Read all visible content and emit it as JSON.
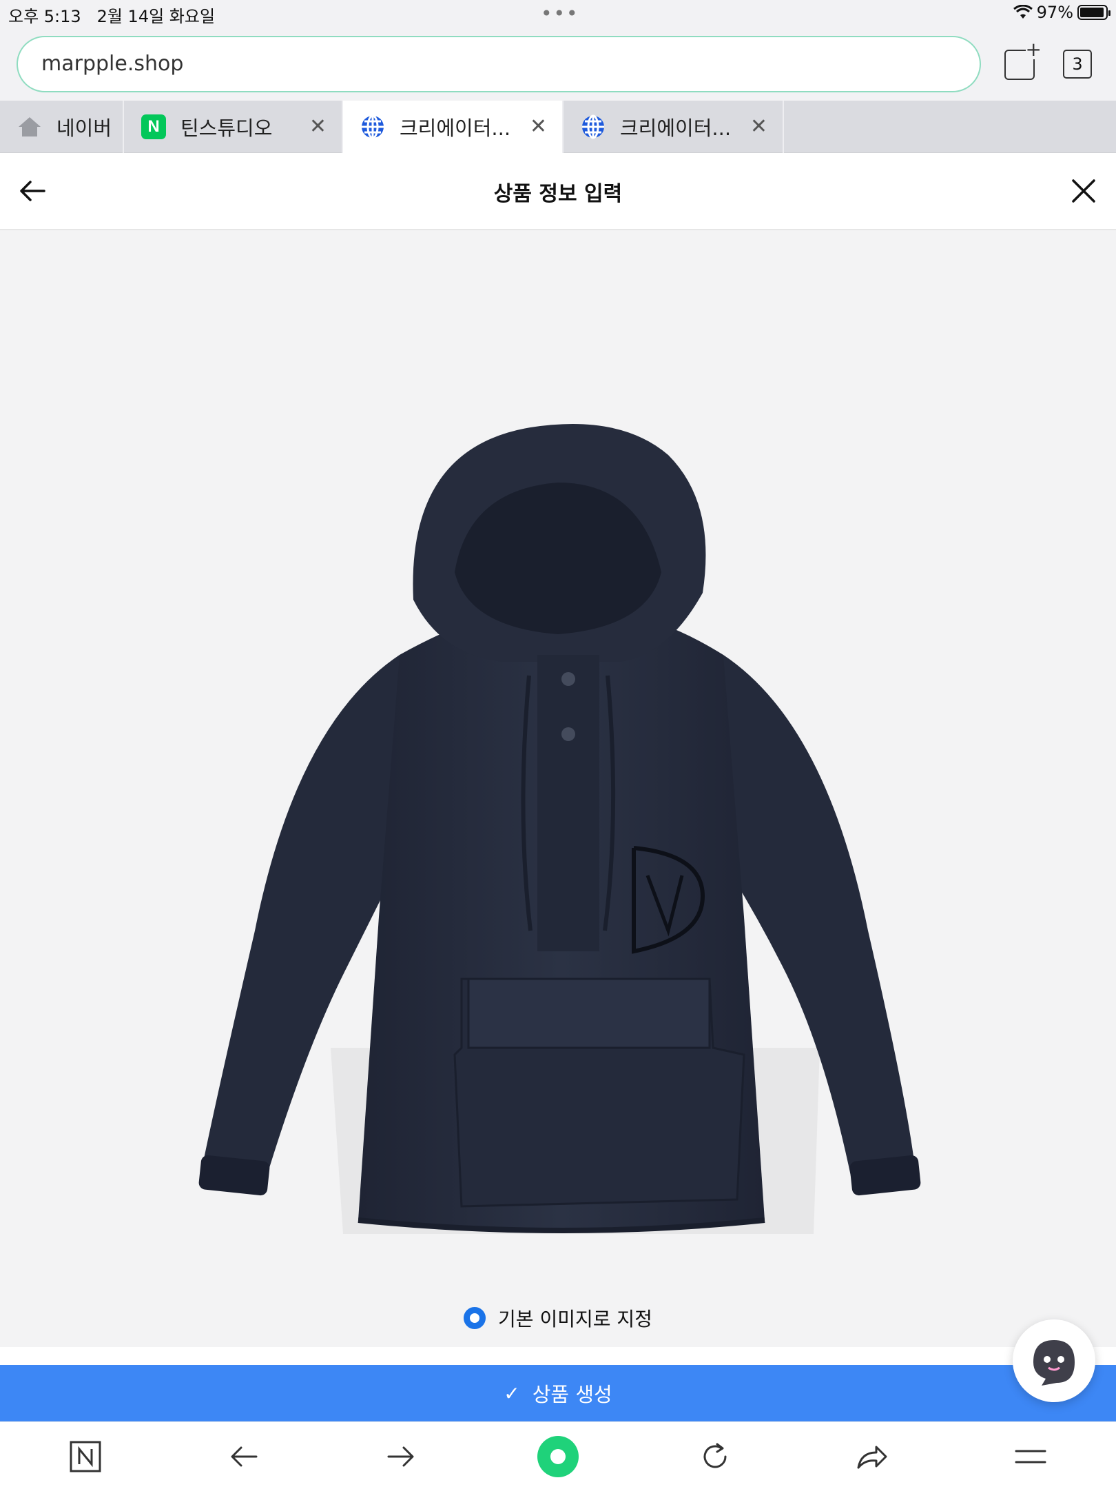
{
  "status_bar": {
    "time": "오후 5:13",
    "date": "2월 14일 화요일",
    "battery": "97%",
    "battery_level": 0.97
  },
  "browser": {
    "url": "marpple.shop",
    "tab_count": "3",
    "tabs": [
      {
        "label": "네이버",
        "icon": "home-icon"
      },
      {
        "label": "틴스튜디오",
        "icon": "naver-icon"
      },
      {
        "label": "크리에이터...",
        "icon": "globe-icon",
        "active": true
      },
      {
        "label": "크리에이터...",
        "icon": "globe-icon"
      }
    ],
    "naver_letter": "N"
  },
  "header": {
    "title": "상품 정보 입력"
  },
  "product": {
    "image_alt": "navy anorak hooded jacket with kangaroo pocket and D logo"
  },
  "default_image": {
    "label": "기본 이미지로 지정",
    "selected": true
  },
  "actions": {
    "create_label": "상품 생성"
  },
  "colors": {
    "primary": "#3d87f5",
    "radio": "#1a73e8",
    "naver_green": "#03c75a",
    "url_border": "#8fdcc0",
    "jacket": "#262c3d"
  }
}
